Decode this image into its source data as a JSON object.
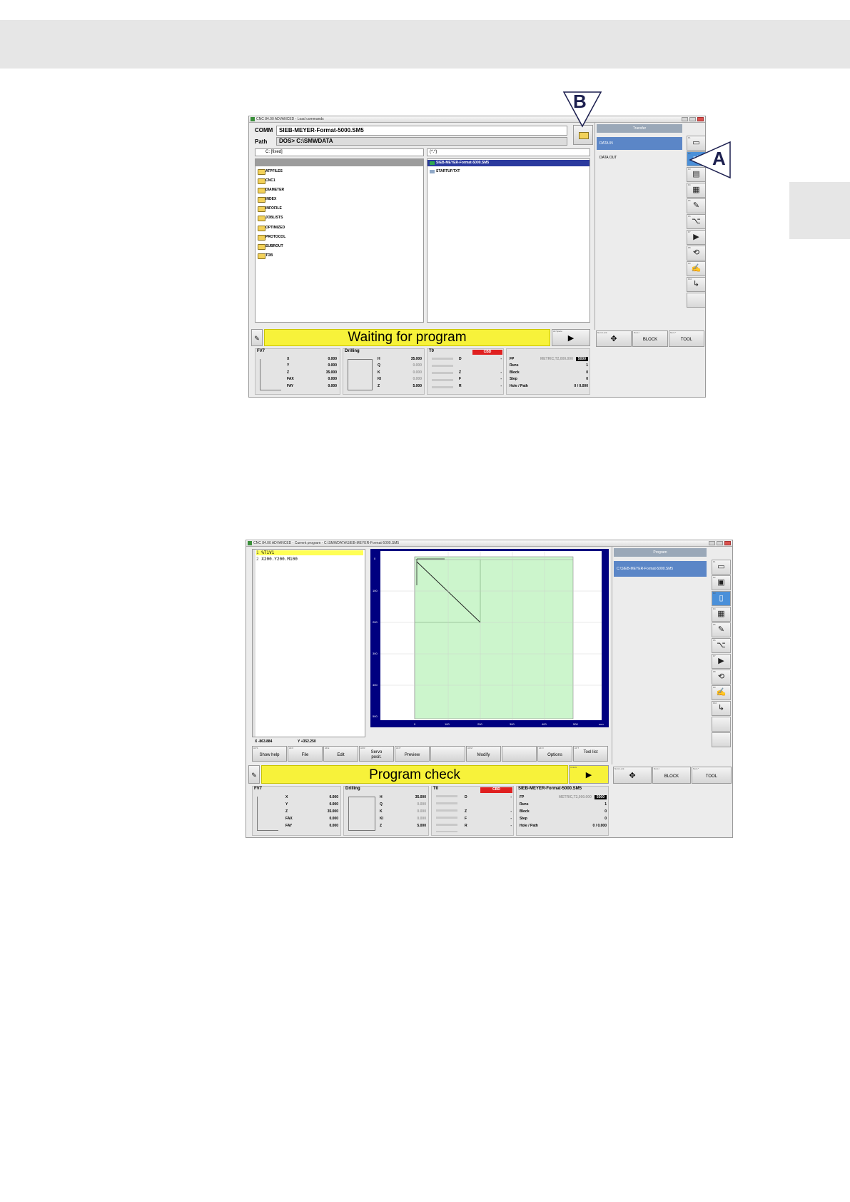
{
  "callouts": {
    "a": "A",
    "b": "B"
  },
  "shot1": {
    "title": "CNC 84.00 ADVANCED - Load commands",
    "comm_label": "COMM",
    "comm_value": "SIEB-MEYER-Format-5000.SM5",
    "path_label": "Path",
    "path_value": "DOS> C:\\SMWDATA",
    "drive_select": "C: [fixed]",
    "filter_select": "(*.*)",
    "folders": [
      "ATPFILES",
      "CNC1",
      "DIAMETER",
      "INDEX",
      "INFOFILE",
      "JOBLISTS",
      "OPTIMIZED",
      "PROTOCOL",
      "SUBROUT",
      "TDB"
    ],
    "files": [
      "SIEB-MEYER-Format-5000.SM5",
      "STARTUP.TXT"
    ],
    "right_header": "Transfer",
    "right_items": [
      "DATA IN",
      "DATA OUT"
    ],
    "status": "Waiting for program",
    "block_label": "BLOCK",
    "tool_label": "TOOL"
  },
  "shot2": {
    "title": "CNC 84.00 ADVANCED - Current program - C:\\SMWDATA\\SIEB-MEYER-Format-5000.SM5",
    "program_lines": [
      "%T1V1",
      "X200.Y200.M100"
    ],
    "graph_ticks_y": [
      "0",
      "100",
      "200",
      "300",
      "400",
      "500"
    ],
    "graph_ticks_x": [
      "0",
      "100",
      "200",
      "300",
      "400",
      "500",
      "mm"
    ],
    "coord_x": "X -863.884",
    "coord_y": "Y +352.250",
    "right_header": "Program",
    "right_item": "C:\\SIEB-MEYER-Format-5000.SM5",
    "softkeys": [
      "Show help",
      "File",
      "Edit",
      "Servo posit.",
      "Preview",
      "",
      "Modify",
      "",
      "Options",
      "Tool list"
    ],
    "status": "Program check",
    "block_label": "BLOCK",
    "tool_label": "TOOL",
    "program_name": "SIEB-MEYER-Format-5000.SM5"
  },
  "info": {
    "fv_title": "FV7",
    "axes": [
      {
        "k": "X",
        "v": "0.000"
      },
      {
        "k": "Y",
        "v": "0.000"
      },
      {
        "k": "Z",
        "v": "35.000"
      },
      {
        "k": "FAX",
        "v": "0.000"
      },
      {
        "k": "FAY",
        "v": "0.000"
      }
    ],
    "drill_title": "Drilling",
    "drill": [
      {
        "k": "H",
        "v": "35.000"
      },
      {
        "k": "Q",
        "v": "0.000"
      },
      {
        "k": "K",
        "v": "0.000"
      },
      {
        "k": "KI",
        "v": "0.000"
      },
      {
        "k": "Z",
        "v": "5.000"
      }
    ],
    "tool_title": "T0",
    "cbd": "CBD",
    "tool": [
      {
        "k": "D",
        "v": "-"
      },
      {
        "k": "Z",
        "v": "-"
      },
      {
        "k": "F",
        "v": "-"
      },
      {
        "k": "R",
        "v": "-"
      }
    ],
    "fp_label": "FP",
    "fp_format": "METRIC,T2,000.000",
    "fp_value": "5000",
    "runs_label": "Runs",
    "runs_value": "1",
    "block_label": "Block",
    "block_value": "0",
    "step_label": "Step",
    "step_value": "0",
    "hole_label": "Hole / Path",
    "hole_value": "0 / 0.000"
  }
}
